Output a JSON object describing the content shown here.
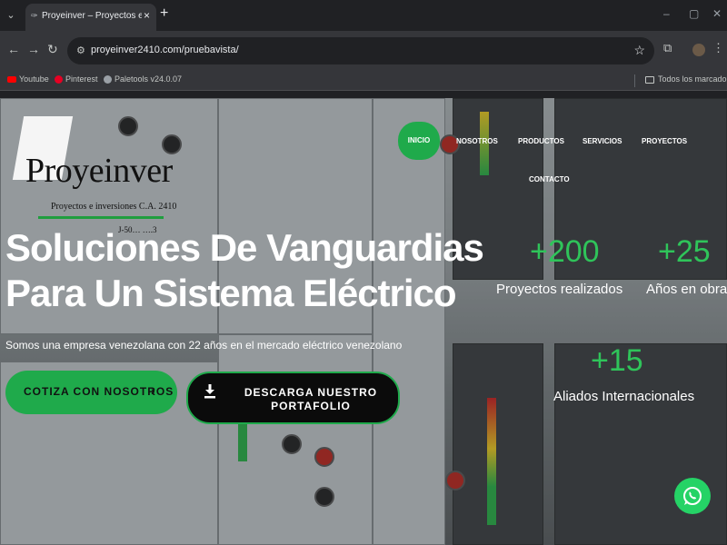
{
  "browser": {
    "tab_title": "Proyeinver – Proyectos e Inversi",
    "tab_close": "×",
    "new_tab": "+",
    "url": "proyeinver2410.com/pruebavista/",
    "window_controls": [
      "–",
      "▢",
      "✕"
    ],
    "bookmarks": [
      "Youtube",
      "Pinterest",
      "Paletools v24.0.07"
    ],
    "bookmarks_folder": "Todos los marcadores"
  },
  "site": {
    "logo": {
      "wordmark": "Proyeinver",
      "tagline": "Proyectos e inversiones C.A. 2410",
      "rif": "J-50… ….3"
    },
    "nav": [
      "INICIO",
      "NOSOTROS",
      "PRODUCTOS",
      "SERVICIOS",
      "PROYECTOS",
      "CONTACTO"
    ],
    "hero": {
      "title_line1": "Soluciones De Vanguardias",
      "title_line2": "Para Un Sistema Eléctrico",
      "subtitle": "Somos una empresa venezolana con 22 años en el mercado eléctrico venezolano",
      "cta_primary": "COTIZA CON NOSOTROS",
      "cta_primary_chevron": "›",
      "cta_secondary_line1": "DESCARGA NUESTRO",
      "cta_secondary_line2": "PORTAFOLIO"
    },
    "stats": [
      {
        "value": "+200",
        "label": "Proyectos realizados"
      },
      {
        "value": "+25",
        "label": "Años en obras"
      },
      {
        "value": "+15",
        "label": "Aliados Internacionales"
      }
    ]
  },
  "colors": {
    "accent_green": "#1faa4b",
    "stat_green": "#2fc45a",
    "whatsapp": "#25d366"
  },
  "icons": {
    "whatsapp": "whatsapp-icon",
    "download": "download-icon"
  }
}
